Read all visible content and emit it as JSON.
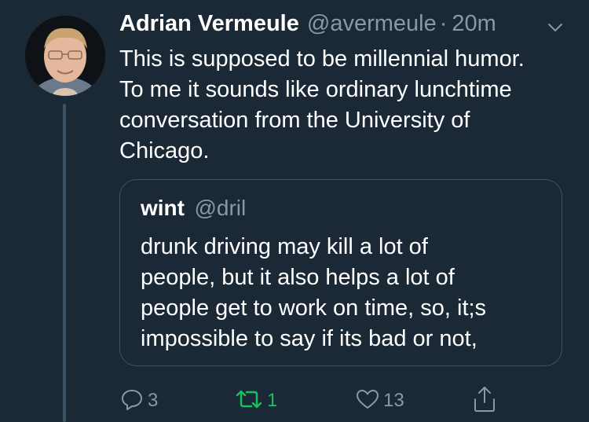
{
  "tweet": {
    "author_name": "Adrian Vermeule",
    "author_handle": "@avermeule",
    "separator": "·",
    "time": "20m",
    "lines": [
      "This is supposed to be millennial humor.",
      "To me it sounds like ordinary lunchtime",
      "conversation from the University of",
      "Chicago."
    ]
  },
  "quote": {
    "author_name": "wint",
    "author_handle": "@dril",
    "lines": [
      "drunk driving may kill a lot of",
      "people, but it also helps a lot of",
      "people get to work on time, so, it;s",
      "impossible to say if its bad or not,"
    ]
  },
  "actions": {
    "reply_count": "3",
    "retweet_count": "1",
    "like_count": "13"
  },
  "icons": {
    "reply": "reply-icon",
    "retweet": "retweet-icon",
    "like": "heart-icon",
    "share": "share-icon",
    "menu": "chevron-down-icon"
  },
  "colors": {
    "background": "#1b2836",
    "secondary_text": "#8899a6",
    "retweet_active": "#17bf63",
    "border": "#3d5466"
  }
}
